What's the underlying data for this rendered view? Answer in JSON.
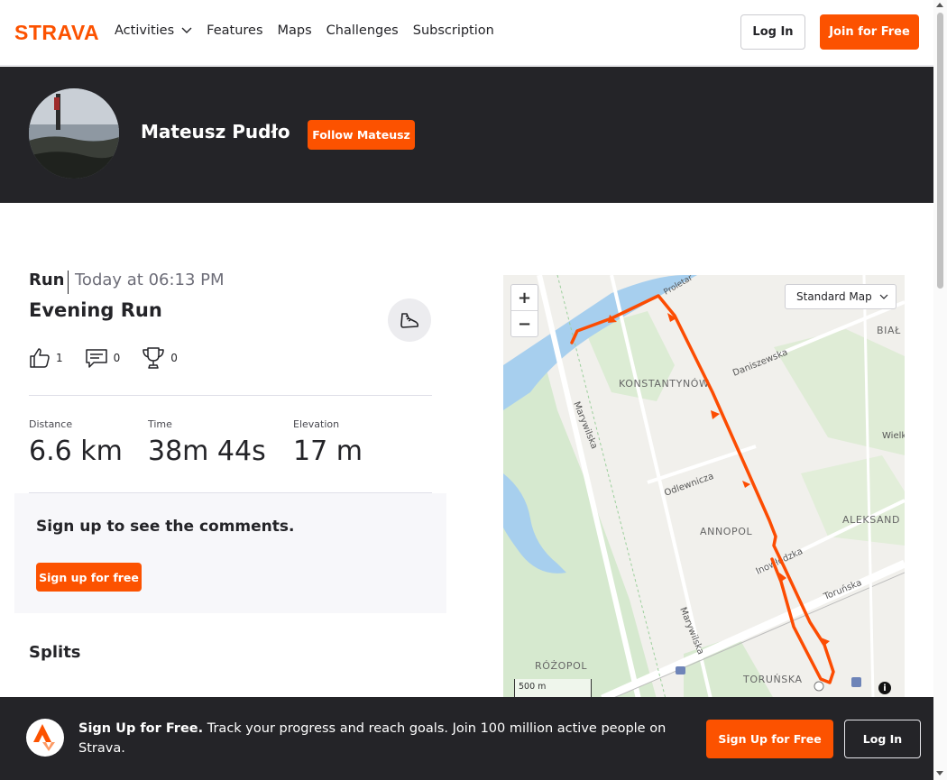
{
  "nav": {
    "logo_text": "STRAVA",
    "links": [
      "Activities",
      "Features",
      "Maps",
      "Challenges",
      "Subscription"
    ],
    "login_label": "Log In",
    "join_label": "Join for Free"
  },
  "profile": {
    "name": "Mateusz Pudło",
    "follow_label": "Follow Mateusz"
  },
  "activity": {
    "type": "Run",
    "date": "Today at 06:13 PM",
    "title": "Evening Run",
    "kudos": "1",
    "comments": "0",
    "achievements": "0",
    "stats": [
      {
        "label": "Distance",
        "value": "6.6 km"
      },
      {
        "label": "Time",
        "value": "38m 44s"
      },
      {
        "label": "Elevation",
        "value": "17 m"
      }
    ]
  },
  "comments": {
    "title": "Sign up to see the comments.",
    "button_label": "Sign up for free"
  },
  "splits": {
    "title": "Splits"
  },
  "map": {
    "style_label": "Standard Map",
    "scale_label": "500 m",
    "route_color": "#fc4c02",
    "places": [
      "KONSTANTYNÓW",
      "ANNOPOL",
      "RÓŻOPOL",
      "TORUŃSKA",
      "ALEKSAND",
      "BIAŁ",
      "Marywilska",
      "Daniszewska",
      "Odlewnicza",
      "Inowłodzka",
      "Toruńska",
      "Wielk",
      "Proletar"
    ]
  },
  "banner": {
    "bold_text": "Sign Up for Free.",
    "text": " Track your progress and reach goals. Join 100 million active people on Strava.",
    "signup_label": "Sign Up for Free",
    "login_label": "Log In"
  },
  "colors": {
    "brand": "#fc5200",
    "dark": "#242428"
  }
}
